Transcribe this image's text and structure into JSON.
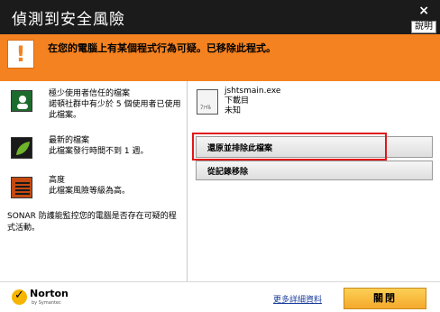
{
  "window": {
    "title": "偵測到安全風險",
    "close_glyph": "×",
    "help_label": "說明"
  },
  "alert": {
    "icon": "warning-icon",
    "glyph": "!",
    "message": "在您的電腦上有某個程式行為可疑。已移除此程式。",
    "bg_color": "#f58220"
  },
  "details": [
    {
      "icon": "users-icon",
      "icon_color": "#1e6b2e",
      "title": "極少使用者信任的檔案",
      "text": "諾頓社群中有少於 5 個使用者已使用此檔案。"
    },
    {
      "icon": "leaf-icon",
      "icon_color": "#2e6b1a",
      "title": "最新的檔案",
      "text": "此檔案發行時間不到 1 週。"
    },
    {
      "icon": "severity-bars-icon",
      "icon_color": "#c44a12",
      "title": "高度",
      "text": "此檔案風險等級為高。"
    }
  ],
  "sonar_note": "SONAR 防護能監控您的電腦是否存在可疑的程式活動。",
  "file": {
    "icon": "file-icon",
    "icon_label": "ﾌｧｲﾙ",
    "name": "jshtsmain.exe",
    "folder": "下載目",
    "status": "未知"
  },
  "actions": {
    "restore_label": "還原並排除此檔案",
    "remove_label": "從記錄移除"
  },
  "footer": {
    "brand": "Norton",
    "brand_sub": "by Symantec",
    "more_link": "更多詳細資料",
    "close_label": "關閉"
  }
}
